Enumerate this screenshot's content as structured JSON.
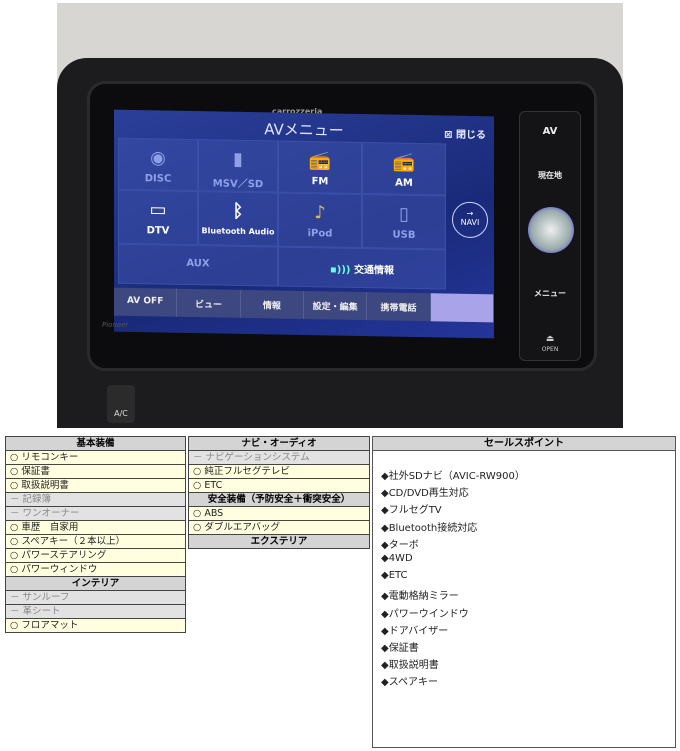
{
  "photo": {
    "brand": "carrozzeria",
    "screen_title": "AVメニュー",
    "close_label": "閉じる",
    "tiles": [
      "DISC",
      "MSV／SD",
      "FM",
      "AM",
      "DTV",
      "Bluetooth Audio",
      "iPod",
      "USB",
      "AUX",
      "交通情報"
    ],
    "navi_label": "NAVI",
    "bottom_tabs": [
      "AV OFF",
      "ビュー",
      "情報",
      "設定・編集",
      "携帯電話",
      ""
    ],
    "side_av": "AV",
    "side_current": "現在地",
    "side_menu": "メニュー",
    "side_open": "OPEN",
    "pioneer": "Pioneer",
    "ac": "A/C"
  },
  "basic": {
    "header": "基本装備",
    "items": [
      {
        "mark": "○",
        "label": "リモコンキー",
        "on": true
      },
      {
        "mark": "○",
        "label": "保証書",
        "on": true
      },
      {
        "mark": "○",
        "label": "取扱説明書",
        "on": true
      },
      {
        "mark": "－",
        "label": "記録簿",
        "on": false
      },
      {
        "mark": "－",
        "label": "ワンオーナー",
        "on": false
      },
      {
        "mark": "○",
        "label": "車歴　自家用",
        "on": true
      },
      {
        "mark": "○",
        "label": "スペアキー（２本以上）",
        "on": true
      },
      {
        "mark": "○",
        "label": "パワーステアリング",
        "on": true
      },
      {
        "mark": "○",
        "label": "パワーウィンドウ",
        "on": true
      }
    ]
  },
  "interior": {
    "header": "インテリア",
    "items": [
      {
        "mark": "－",
        "label": "サンルーフ",
        "on": false
      },
      {
        "mark": "－",
        "label": "革シート",
        "on": false
      },
      {
        "mark": "○",
        "label": "フロアマット",
        "on": true
      }
    ]
  },
  "navi_audio": {
    "header": "ナビ・オーディオ",
    "items": [
      {
        "mark": "－",
        "label": "ナビゲーションシステム",
        "on": false
      },
      {
        "mark": "○",
        "label": "純正フルセグテレビ",
        "on": true
      },
      {
        "mark": "○",
        "label": "ETC",
        "on": true
      }
    ]
  },
  "safety": {
    "header": "安全装備（予防安全＋衝突安全）",
    "items": [
      {
        "mark": "○",
        "label": "ABS",
        "on": true
      },
      {
        "mark": "○",
        "label": "ダブルエアバッグ",
        "on": true
      }
    ]
  },
  "exterior": {
    "header": "エクステリア"
  },
  "sales_points": {
    "header": "セールスポイント",
    "items": [
      "◆社外SDナビ（AVIC-RW900）",
      "◆CD/DVD再生対応",
      "◆フルセグTV",
      "◆Bluetooth接続対応",
      "◆ターボ",
      "◆4WD",
      "◆ETC",
      "◆電動格納ミラー",
      "◆パワーウインドウ",
      "◆ドアバイザー",
      "◆保証書",
      "◆取扱説明書",
      "◆スペアキー"
    ]
  }
}
